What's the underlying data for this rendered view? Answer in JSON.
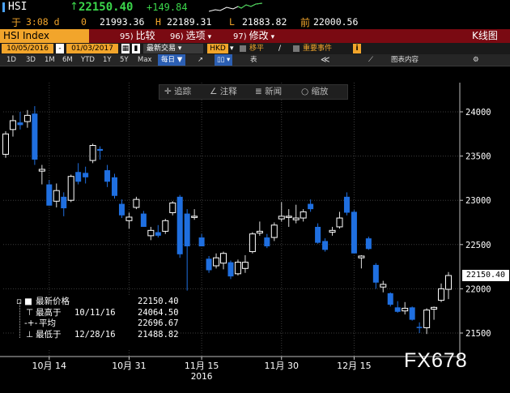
{
  "header": {
    "symbol": "HSI",
    "arrow": "↑",
    "last": "22150.40",
    "change": "+149.84",
    "period_prefix": "于",
    "time": "3:08 d",
    "open_label": "0",
    "open": "21993.36",
    "high_label": "H",
    "high": "22189.31",
    "low_label": "L",
    "low": "21883.82",
    "prev_label": "前",
    "prev": "22000.56"
  },
  "menu": {
    "index_name": "HSI Index",
    "compare_num": "95)",
    "compare": "比较",
    "options_num": "96)",
    "options": "选项",
    "modify_num": "97)",
    "modify": "修改",
    "kline": "K线图"
  },
  "datebar": {
    "start": "10/05/2016",
    "end": "01/03/2017",
    "last_trade": "最新交易",
    "currency": "HKD",
    "move": "移平",
    "events": "重要事件",
    "info": "i"
  },
  "periods": [
    "1D",
    "3D",
    "1M",
    "6M",
    "YTD",
    "1Y",
    "5Y",
    "Max"
  ],
  "period_selected": "每日",
  "period_icons": {
    "chart": "↗",
    "table": "表",
    "back": "≪",
    "content": "图表内容",
    "gear": "⚙"
  },
  "toolbar": {
    "track": "追踪",
    "annotate": "注释",
    "news": "新闻",
    "zoom": "缩放"
  },
  "legend": {
    "last_label": "最新价格",
    "last_value": "22150.40",
    "high_label": "最高于",
    "high_date": "10/11/16",
    "high_value": "24064.50",
    "avg_label": "平均",
    "avg_value": "22696.67",
    "low_label": "最低于",
    "low_date": "12/28/16",
    "low_value": "21488.82"
  },
  "price_tag": "22150.40",
  "watermark": "FX678",
  "colors": {
    "up": "#ffffff",
    "down": "#1f6fe0",
    "menu": "#7a0a12",
    "accent": "#f2a52b"
  },
  "chart_data": {
    "type": "candlestick",
    "ylim": [
      21250,
      24300
    ],
    "yticks": [
      21500,
      22000,
      22500,
      23000,
      23500,
      24000
    ],
    "ytick_labels": [
      "21500",
      "22000",
      "22500",
      "23000",
      "23500",
      "24000"
    ],
    "xtick_labels": [
      "10月 14",
      "10月 31",
      "11月 15",
      "11月 30",
      "12月 15"
    ],
    "xtick_index": [
      6,
      17,
      27,
      38,
      48
    ],
    "year_label": "2016",
    "grid": true,
    "candles": [
      {
        "d": "10/05",
        "o": 23520,
        "h": 23780,
        "l": 23480,
        "c": 23750
      },
      {
        "d": "10/06",
        "o": 23800,
        "h": 23960,
        "l": 23720,
        "c": 23900
      },
      {
        "d": "10/07",
        "o": 23880,
        "h": 24000,
        "l": 23800,
        "c": 23850
      },
      {
        "d": "10/10",
        "o": 23890,
        "h": 24020,
        "l": 23820,
        "c": 23960
      },
      {
        "d": "10/11",
        "o": 23980,
        "h": 24064,
        "l": 23400,
        "c": 23460
      },
      {
        "d": "10/12",
        "o": 23330,
        "h": 23400,
        "l": 23180,
        "c": 23350
      },
      {
        "d": "10/13",
        "o": 23180,
        "h": 23230,
        "l": 22940,
        "c": 22940
      },
      {
        "d": "10/14",
        "o": 22990,
        "h": 23190,
        "l": 22920,
        "c": 23110
      },
      {
        "d": "10/17",
        "o": 23040,
        "h": 23090,
        "l": 22820,
        "c": 22910
      },
      {
        "d": "10/18",
        "o": 23000,
        "h": 23290,
        "l": 22980,
        "c": 23270
      },
      {
        "d": "10/19",
        "o": 23320,
        "h": 23420,
        "l": 23180,
        "c": 23210
      },
      {
        "d": "10/20",
        "o": 23310,
        "h": 23380,
        "l": 23190,
        "c": 23260
      },
      {
        "d": "10/21",
        "o": 23450,
        "h": 23640,
        "l": 23420,
        "c": 23620
      },
      {
        "d": "10/24",
        "o": 23580,
        "h": 23610,
        "l": 23460,
        "c": 23560
      },
      {
        "d": "10/25",
        "o": 23340,
        "h": 23400,
        "l": 23150,
        "c": 23210
      },
      {
        "d": "10/26",
        "o": 23260,
        "h": 23300,
        "l": 23020,
        "c": 23050
      },
      {
        "d": "10/27",
        "o": 22960,
        "h": 23010,
        "l": 22800,
        "c": 22830
      },
      {
        "d": "10/28",
        "o": 22770,
        "h": 22860,
        "l": 22680,
        "c": 22810
      },
      {
        "d": "10/31",
        "o": 22920,
        "h": 23040,
        "l": 22900,
        "c": 23010
      },
      {
        "d": "11/01",
        "o": 22850,
        "h": 22880,
        "l": 22700,
        "c": 22700
      },
      {
        "d": "11/02",
        "o": 22600,
        "h": 22700,
        "l": 22550,
        "c": 22660
      },
      {
        "d": "11/03",
        "o": 22640,
        "h": 22720,
        "l": 22580,
        "c": 22600
      },
      {
        "d": "11/04",
        "o": 22650,
        "h": 22790,
        "l": 22620,
        "c": 22770
      },
      {
        "d": "11/07",
        "o": 22860,
        "h": 22990,
        "l": 22830,
        "c": 22970
      },
      {
        "d": "11/08",
        "o": 23040,
        "h": 23060,
        "l": 22350,
        "c": 22390
      },
      {
        "d": "11/09",
        "o": 22850,
        "h": 22900,
        "l": 21980,
        "c": 22480
      },
      {
        "d": "11/10",
        "o": 22820,
        "h": 22900,
        "l": 22780,
        "c": 22820
      },
      {
        "d": "11/11",
        "o": 22580,
        "h": 22620,
        "l": 22480,
        "c": 22480
      },
      {
        "d": "11/14",
        "o": 22340,
        "h": 22370,
        "l": 22180,
        "c": 22210
      },
      {
        "d": "11/15",
        "o": 22260,
        "h": 22400,
        "l": 22230,
        "c": 22350
      },
      {
        "d": "11/16",
        "o": 22290,
        "h": 22420,
        "l": 22220,
        "c": 22400
      },
      {
        "d": "11/17",
        "o": 22300,
        "h": 22320,
        "l": 22110,
        "c": 22140
      },
      {
        "d": "11/18",
        "o": 22170,
        "h": 22330,
        "l": 22150,
        "c": 22300
      },
      {
        "d": "11/21",
        "o": 22230,
        "h": 22380,
        "l": 22180,
        "c": 22300
      },
      {
        "d": "11/22",
        "o": 22420,
        "h": 22640,
        "l": 22400,
        "c": 22620
      },
      {
        "d": "11/23",
        "o": 22630,
        "h": 22760,
        "l": 22600,
        "c": 22650
      },
      {
        "d": "11/24",
        "o": 22580,
        "h": 22620,
        "l": 22460,
        "c": 22480
      },
      {
        "d": "11/25",
        "o": 22580,
        "h": 22750,
        "l": 22540,
        "c": 22720
      },
      {
        "d": "11/28",
        "o": 22790,
        "h": 22980,
        "l": 22760,
        "c": 22820
      },
      {
        "d": "11/29",
        "o": 22820,
        "h": 22900,
        "l": 22700,
        "c": 22820
      },
      {
        "d": "11/30",
        "o": 22780,
        "h": 22950,
        "l": 22740,
        "c": 22800
      },
      {
        "d": "12/01",
        "o": 22800,
        "h": 22900,
        "l": 22760,
        "c": 22870
      },
      {
        "d": "12/02",
        "o": 22960,
        "h": 23010,
        "l": 22870,
        "c": 22900
      },
      {
        "d": "12/05",
        "o": 22700,
        "h": 22740,
        "l": 22510,
        "c": 22520
      },
      {
        "d": "12/06",
        "o": 22540,
        "h": 22570,
        "l": 22420,
        "c": 22440
      },
      {
        "d": "12/07",
        "o": 22640,
        "h": 22700,
        "l": 22600,
        "c": 22660
      },
      {
        "d": "12/08",
        "o": 22700,
        "h": 22870,
        "l": 22680,
        "c": 22800
      },
      {
        "d": "12/09",
        "o": 23040,
        "h": 23090,
        "l": 22830,
        "c": 22860
      },
      {
        "d": "12/12",
        "o": 22870,
        "h": 22890,
        "l": 22400,
        "c": 22400
      },
      {
        "d": "12/13",
        "o": 22350,
        "h": 22380,
        "l": 22230,
        "c": 22370
      },
      {
        "d": "12/14",
        "o": 22570,
        "h": 22590,
        "l": 22440,
        "c": 22450
      },
      {
        "d": "12/15",
        "o": 22270,
        "h": 22290,
        "l": 22000,
        "c": 22070
      },
      {
        "d": "12/16",
        "o": 22020,
        "h": 22090,
        "l": 21960,
        "c": 22050
      },
      {
        "d": "12/19",
        "o": 21950,
        "h": 21960,
        "l": 21800,
        "c": 21820
      },
      {
        "d": "12/20",
        "o": 21790,
        "h": 21860,
        "l": 21730,
        "c": 21740
      },
      {
        "d": "12/21",
        "o": 21750,
        "h": 21850,
        "l": 21710,
        "c": 21780
      },
      {
        "d": "12/22",
        "o": 21790,
        "h": 21800,
        "l": 21640,
        "c": 21650
      },
      {
        "d": "12/23",
        "o": 21570,
        "h": 21620,
        "l": 21500,
        "c": 21560
      },
      {
        "d": "12/28",
        "o": 21560,
        "h": 21780,
        "l": 21489,
        "c": 21760
      },
      {
        "d": "12/29",
        "o": 21770,
        "h": 21800,
        "l": 21650,
        "c": 21790
      },
      {
        "d": "12/30",
        "o": 21870,
        "h": 22060,
        "l": 21850,
        "c": 22000
      },
      {
        "d": "01/03",
        "o": 21994,
        "h": 22189,
        "l": 21884,
        "c": 22150
      }
    ]
  }
}
